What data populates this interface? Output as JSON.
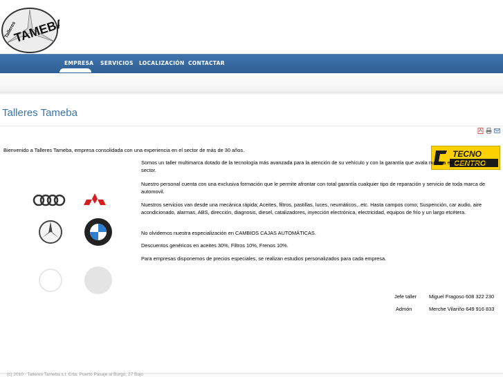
{
  "header": {
    "logo_text_small": "Talleres",
    "logo_text_big": "TAMEBA"
  },
  "nav": {
    "items": [
      {
        "label": "EMPRESA",
        "active": true
      },
      {
        "label": "SERVICIOS"
      },
      {
        "label": "LOCALIZACIÓN"
      },
      {
        "label": "CONTACTAR"
      }
    ]
  },
  "page": {
    "title": "Talleres Tameba",
    "tools": [
      "pdf-icon",
      "print-icon",
      "email-icon"
    ],
    "welcome": "Bienvenido a Talleres Tameba, empresa consolidada con una experiencia en el sector de más de 30 años.",
    "paragraphs": [
      "Somos un taller multimarca dotado de la tecnología más avanzada para la atención de su vehículo y con la garantía que avala nuestra experiencia en el sector.",
      "Nuestro personal cuenta con una exclusiva formación que le permite afrontar con total garantía cualquier tipo de reparación y servicio de toda marca de automovil.",
      "Nuestros servicios van desde una mecánica rápida; Aceites, filtros, pastillas, luces, neumáticos,..etc. Hasta campos como; Suspención, car audio, aire acondicionado, alarmas, ABS, dirección, diagnosis, diesel, catalizadores, inyección electrónica, electricidad, equipos de frío y un largo etcétera.",
      "No olvidemos nuestra especialización en CAMBIOS CAJAS AUTOMÁTICAS.",
      "Descuentos genéricos en aceites 30%, Filtros 10%, Frenos 10%.",
      "Para empresas disponemos de precios especiales, se realizan estudios personalizados para cada empresa."
    ],
    "badge": {
      "line1": "TECNO",
      "line2": "CENTRO"
    },
    "contacts": [
      {
        "role": "Jefe taller",
        "name": "Miguel Fragoso 608 322 230"
      },
      {
        "role": "Admón",
        "name": "Merche Vilariño 649 916 833"
      }
    ]
  },
  "footer": {
    "text": "(c) 2010 · Talleres Tameba s.l. Crta. Puerto Pasaje al Burgo, 27 Bajo"
  }
}
